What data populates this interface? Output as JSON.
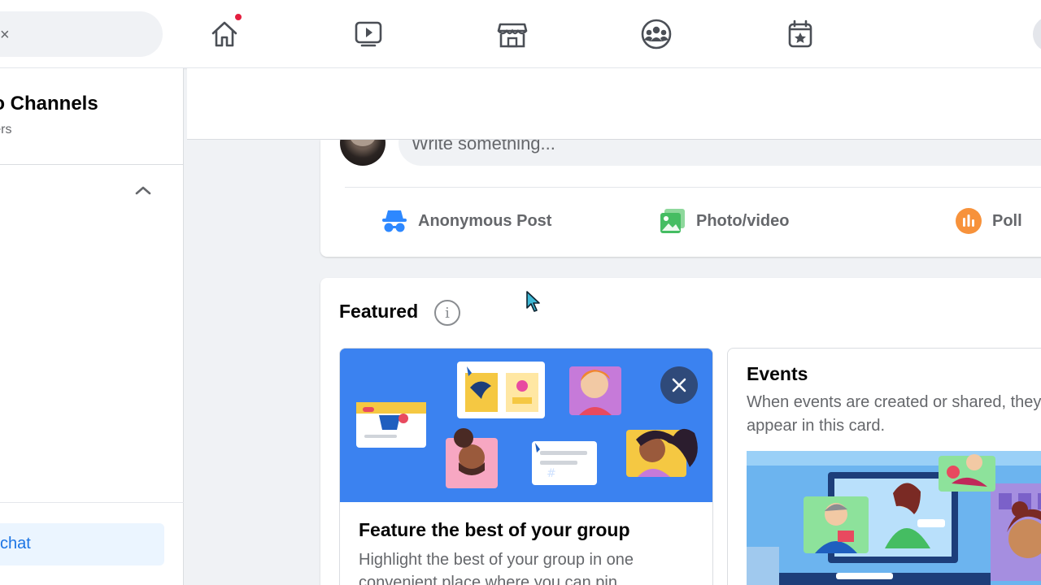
{
  "topnav": {
    "search_clear_glyph": "×",
    "icons": [
      "home-icon",
      "watch-icon",
      "marketplace-icon",
      "groups-icon",
      "gaming-icon"
    ],
    "notification_color": "#e41e3f"
  },
  "sidebar": {
    "group_name": "eo Channels",
    "group_members": "mbers",
    "chat_label": "chat"
  },
  "composer": {
    "placeholder": "Write something...",
    "actions": [
      {
        "label": "Anonymous Post",
        "icon": "incognito-icon",
        "color": "#2d88ff"
      },
      {
        "label": "Photo/video",
        "icon": "photo-icon",
        "color": "#45bd62"
      },
      {
        "label": "Poll",
        "icon": "poll-icon",
        "color": "#f7923b"
      }
    ]
  },
  "featured": {
    "title": "Featured",
    "feature_card": {
      "heading": "Feature the best of your group",
      "description": "Highlight the best of your group in one convenient place where you can pin"
    },
    "events_card": {
      "title": "Events",
      "description": "When events are created or shared, they appear in this card."
    }
  },
  "colors": {
    "accent": "#1b74e4",
    "feature_bg": "#3b82f0",
    "text_secondary": "#65676b"
  }
}
